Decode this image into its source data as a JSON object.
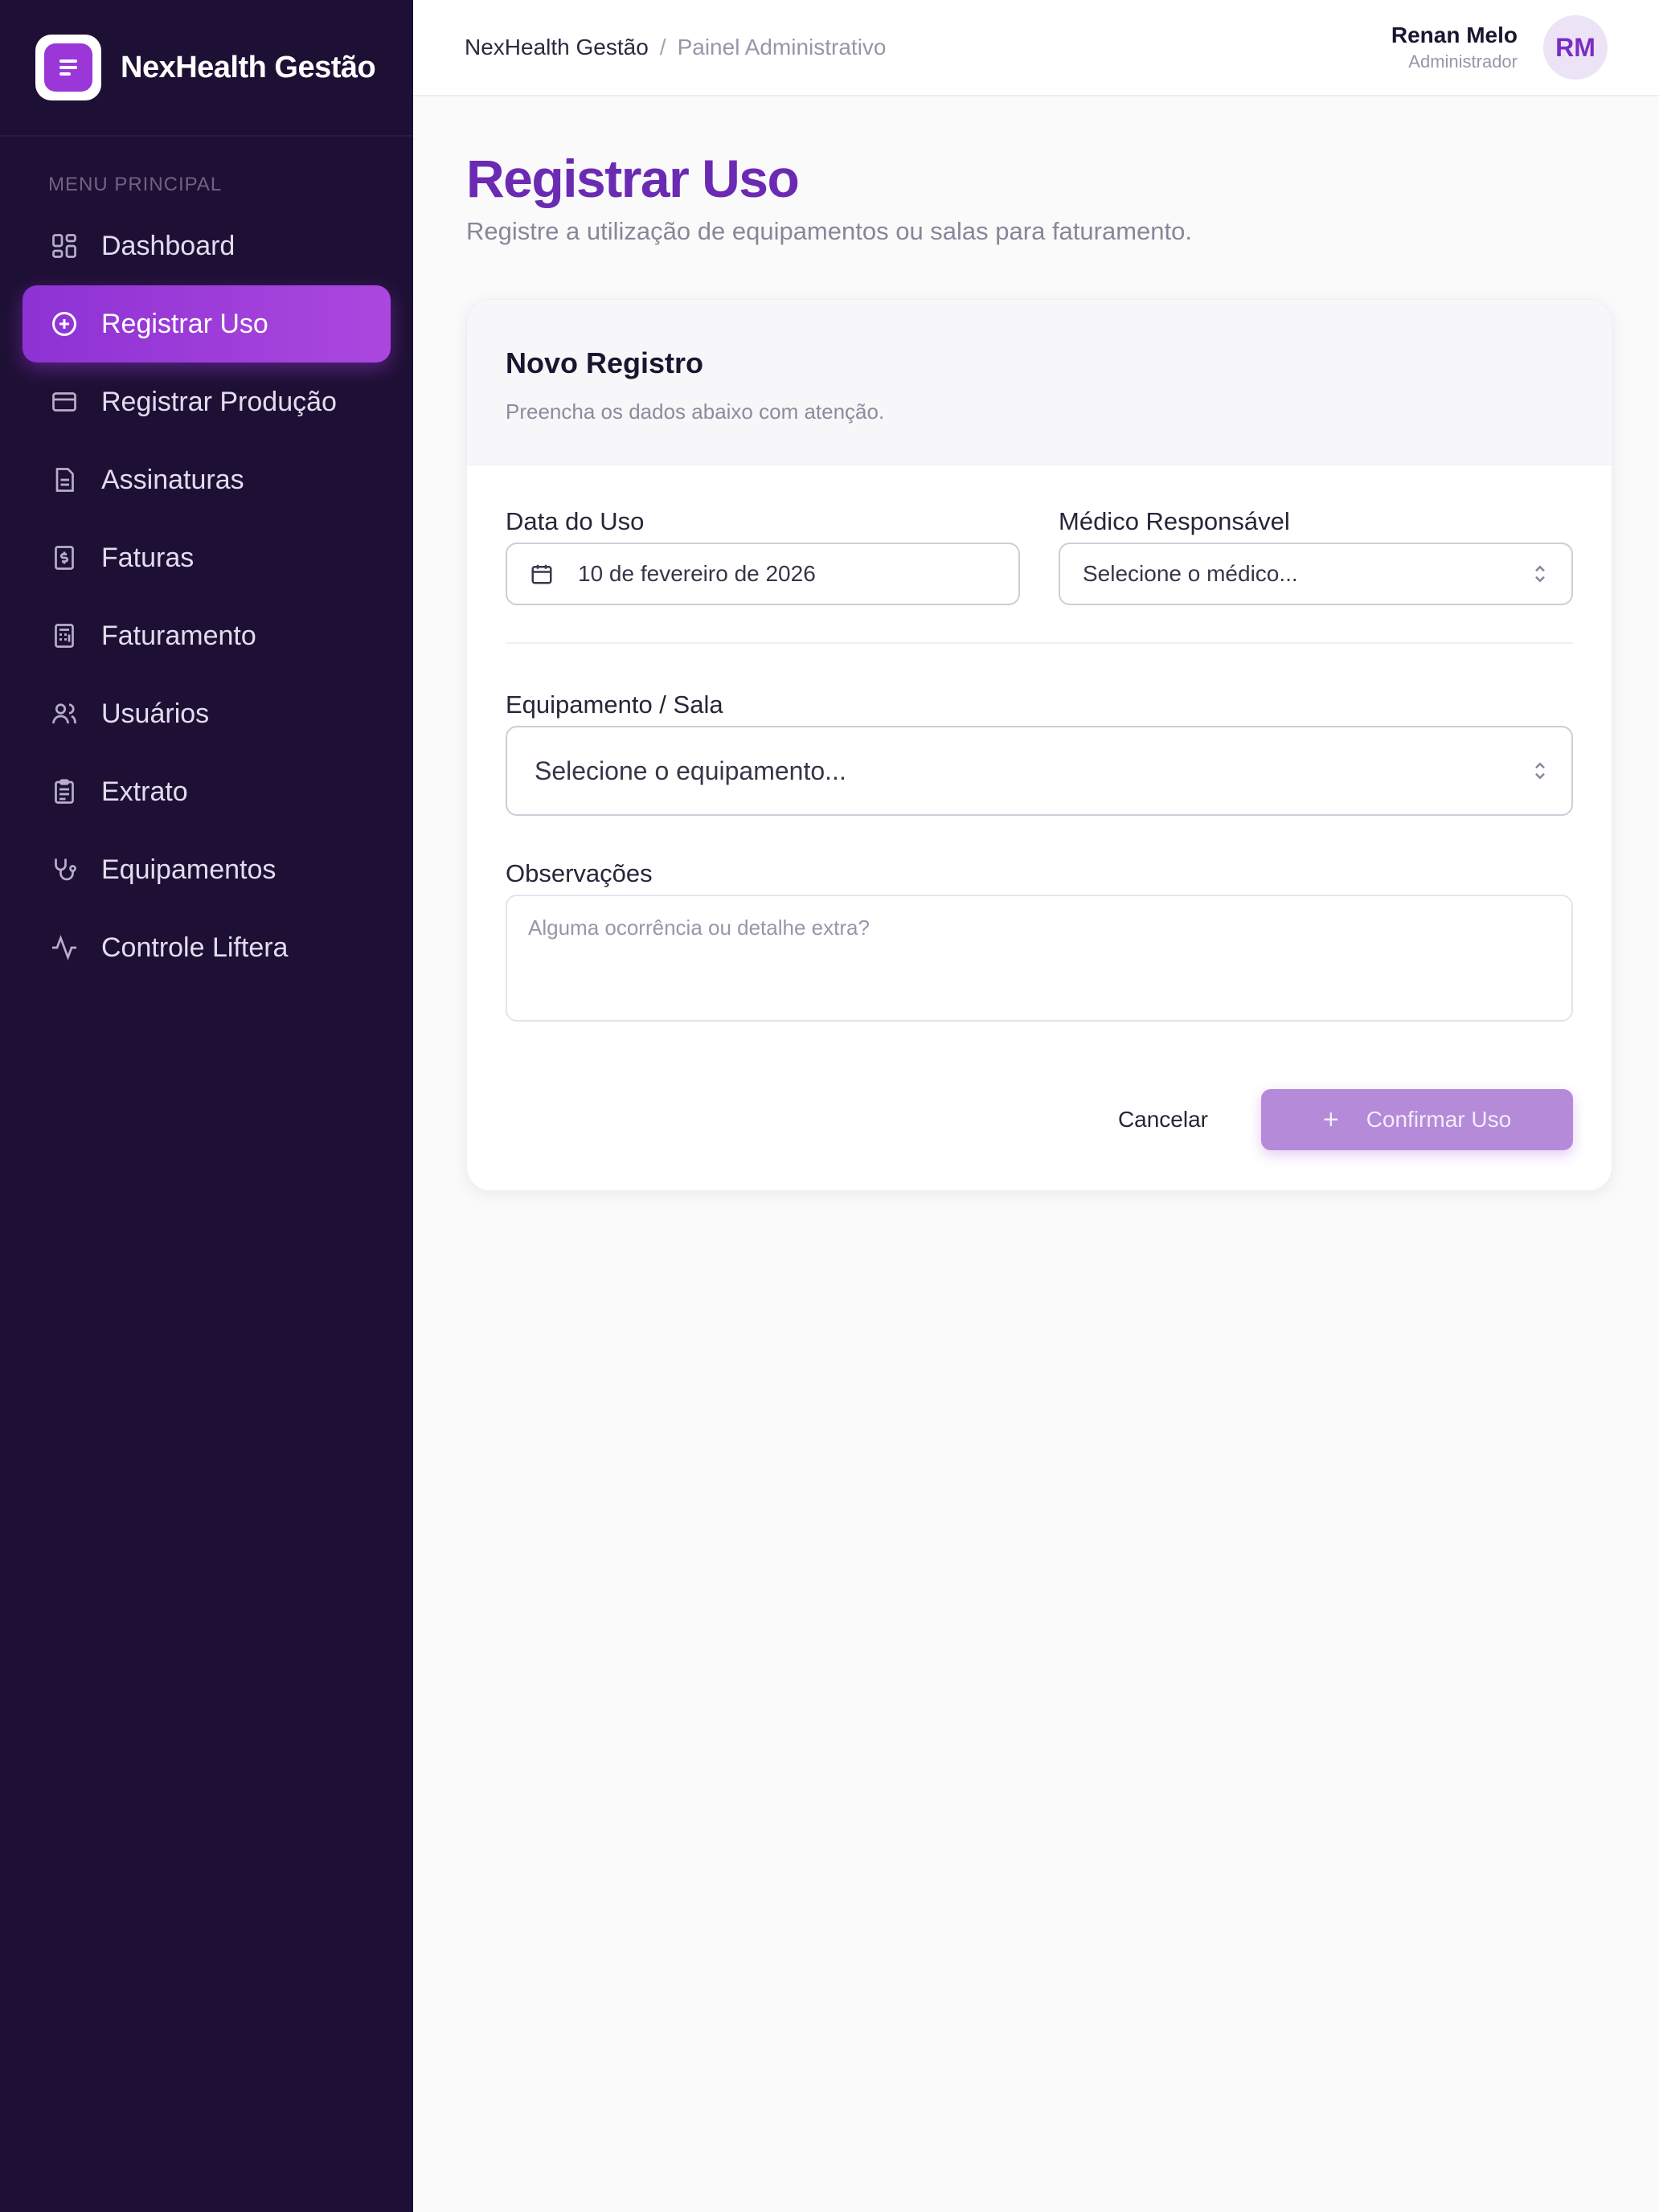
{
  "brand": {
    "name": "NexHealth Gestão"
  },
  "sidebar": {
    "section_label": "MENU PRINCIPAL",
    "items": [
      {
        "label": "Dashboard",
        "icon": "dashboard-icon"
      },
      {
        "label": "Registrar Uso",
        "icon": "plus-circle-icon",
        "active": true
      },
      {
        "label": "Registrar Produção",
        "icon": "credit-card-icon"
      },
      {
        "label": "Assinaturas",
        "icon": "document-icon"
      },
      {
        "label": "Faturas",
        "icon": "invoice-icon"
      },
      {
        "label": "Faturamento",
        "icon": "calculator-icon"
      },
      {
        "label": "Usuários",
        "icon": "users-icon"
      },
      {
        "label": "Extrato",
        "icon": "clipboard-icon"
      },
      {
        "label": "Equipamentos",
        "icon": "stethoscope-icon"
      },
      {
        "label": "Controle Liftera",
        "icon": "activity-icon"
      }
    ]
  },
  "header": {
    "breadcrumb_root": "NexHealth Gestão",
    "breadcrumb_sep": "/",
    "breadcrumb_current": "Painel Administrativo",
    "user_name": "Renan Melo",
    "user_role": "Administrador",
    "user_initials": "RM"
  },
  "page": {
    "title": "Registrar Uso",
    "subtitle": "Registre a utilização de equipamentos ou salas para faturamento."
  },
  "form": {
    "card_title": "Novo Registro",
    "card_desc": "Preencha os dados abaixo com atenção.",
    "date_label": "Data do Uso",
    "date_value": "10 de fevereiro de 2026",
    "doctor_label": "Médico Responsável",
    "doctor_placeholder": "Selecione o médico...",
    "equipment_label": "Equipamento / Sala",
    "equipment_placeholder": "Selecione o equipamento...",
    "notes_label": "Observações",
    "notes_placeholder": "Alguma ocorrência ou detalhe extra?",
    "cancel_label": "Cancelar",
    "confirm_label": "Confirmar Uso"
  },
  "colors": {
    "sidebar_bg": "#1e1034",
    "accent": "#9b36d9",
    "title": "#6a2ab2"
  }
}
